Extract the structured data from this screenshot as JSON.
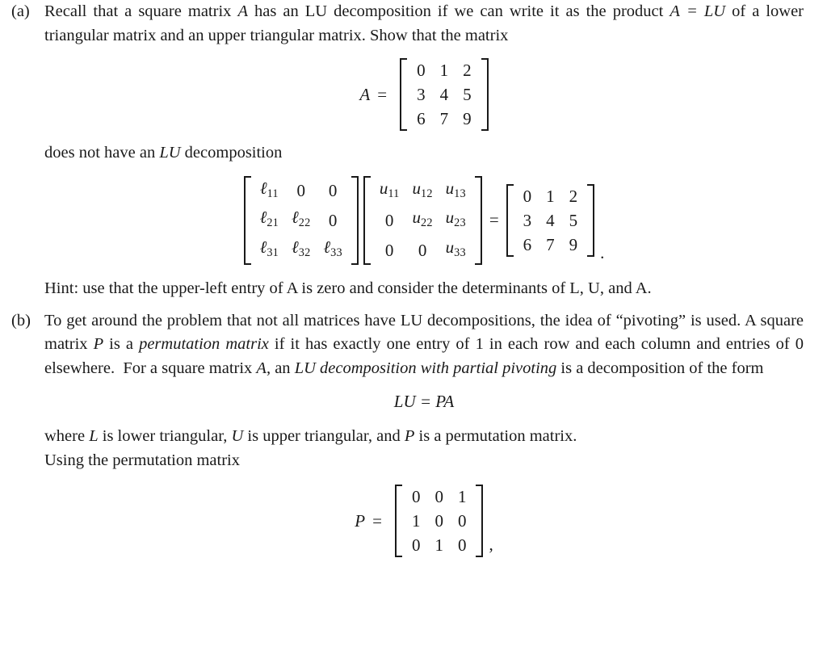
{
  "document": {
    "type": "math-exercise",
    "text_color": "#1a1a1a",
    "background_color": "#ffffff"
  },
  "items": [
    {
      "marker": "(a)",
      "paragraph_lines": [
        "Recall that a square matrix A has an LU decomposition if we can write it as the",
        "product A = LU of a lower triangular matrix and an upper triangular matrix. Show",
        "that the matrix"
      ],
      "paragraph_plain": "Recall that a square matrix A has an LU decomposition if we can write it as the product A = LU of a lower triangular matrix and an upper triangular matrix. Show that the matrix",
      "after_matrix_text": "does not have an LU decomposition",
      "hint": "Hint: use that the upper-left entry of A is zero and consider the determinants of L, U, and A."
    },
    {
      "marker": "(b)",
      "paragraph_plain": "To get around the problem that not all matrices have LU decompositions, the idea of “pivoting” is used. A square matrix P is a permutation matrix if it has exactly one entry of 1 in each row and each column and entries of 0 elsewhere. For a square matrix A, an LU decomposition with partial pivoting is a decomposition of the form",
      "after_formula_text": "where L is lower triangular, U is upper triangular, and P is a permutation matrix. Using the permutation matrix"
    }
  ],
  "matrix_A": {
    "label": "A",
    "equals": "=",
    "rows": [
      [
        "0",
        "1",
        "2"
      ],
      [
        "3",
        "4",
        "5"
      ],
      [
        "6",
        "7",
        "9"
      ]
    ],
    "trailing": ""
  },
  "lu_equation": {
    "L": {
      "rows": [
        [
          "ℓ",
          "11",
          "0",
          "",
          "0",
          ""
        ],
        [
          "ℓ",
          "21",
          "ℓ",
          "22",
          "0",
          ""
        ],
        [
          "ℓ",
          "31",
          "ℓ",
          "32",
          "ℓ",
          "33"
        ]
      ],
      "cells": [
        [
          {
            "sym": "ℓ",
            "sub": "11"
          },
          {
            "sym": "0",
            "sub": ""
          },
          {
            "sym": "0",
            "sub": ""
          }
        ],
        [
          {
            "sym": "ℓ",
            "sub": "21"
          },
          {
            "sym": "ℓ",
            "sub": "22"
          },
          {
            "sym": "0",
            "sub": ""
          }
        ],
        [
          {
            "sym": "ℓ",
            "sub": "31"
          },
          {
            "sym": "ℓ",
            "sub": "32"
          },
          {
            "sym": "ℓ",
            "sub": "33"
          }
        ]
      ]
    },
    "U": {
      "cells": [
        [
          {
            "sym": "u",
            "sub": "11"
          },
          {
            "sym": "u",
            "sub": "12"
          },
          {
            "sym": "u",
            "sub": "13"
          }
        ],
        [
          {
            "sym": "0",
            "sub": ""
          },
          {
            "sym": "u",
            "sub": "22"
          },
          {
            "sym": "u",
            "sub": "23"
          }
        ],
        [
          {
            "sym": "0",
            "sub": ""
          },
          {
            "sym": "0",
            "sub": ""
          },
          {
            "sym": "u",
            "sub": "33"
          }
        ]
      ]
    },
    "equals": "=",
    "RHS": {
      "rows": [
        [
          "0",
          "1",
          "2"
        ],
        [
          "3",
          "4",
          "5"
        ],
        [
          "6",
          "7",
          "9"
        ]
      ]
    },
    "trailing": "."
  },
  "formula_lu_pa": "LU = PA",
  "matrix_P": {
    "label": "P",
    "equals": "=",
    "rows": [
      [
        "0",
        "0",
        "1"
      ],
      [
        "1",
        "0",
        "0"
      ],
      [
        "0",
        "1",
        "0"
      ]
    ],
    "trailing": ","
  }
}
